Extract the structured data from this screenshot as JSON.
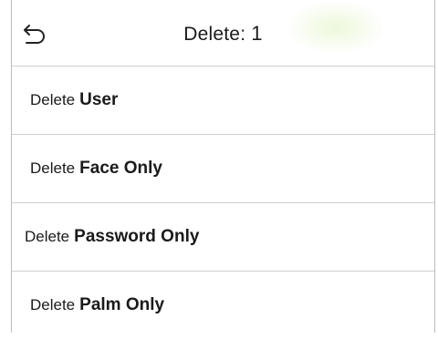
{
  "header": {
    "title": "Delete",
    "separator": ":",
    "count": "1",
    "back_icon": "back-arrow-icon"
  },
  "menu": {
    "items": [
      {
        "prefix": "Delete",
        "label": "User"
      },
      {
        "prefix": "Delete",
        "label": "Face Only"
      },
      {
        "prefix": "Delete",
        "label": "Password Only"
      },
      {
        "prefix": "Delete",
        "label": "Palm Only"
      }
    ]
  }
}
